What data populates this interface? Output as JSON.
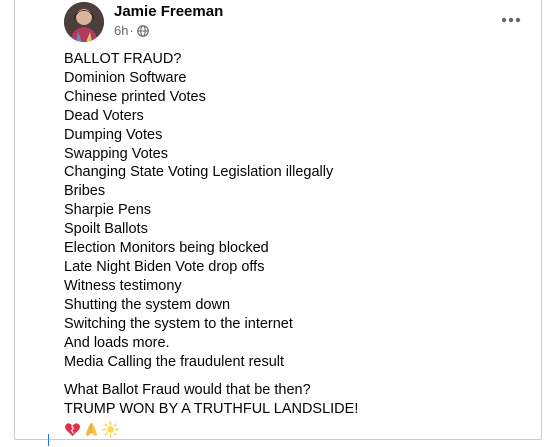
{
  "post": {
    "author": "Jamie Freeman",
    "timestamp": "6h",
    "separator": "·",
    "audience_icon": "globe-icon",
    "menu_icon": "more-options-icon",
    "lines": [
      "BALLOT FRAUD?",
      "Dominion Software",
      "Chinese printed Votes",
      "Dead Voters",
      "Dumping Votes",
      "Swapping Votes",
      "Changing State Voting Legislation illegally",
      "Bribes",
      "Sharpie Pens",
      "Spoilt Ballots",
      "Election Monitors being blocked",
      "Late Night Biden Vote drop offs",
      "Witness testimony",
      "Shutting the system down",
      "Switching the system to the internet",
      "And loads more.",
      "Media Calling the fraudulent result"
    ],
    "closing": [
      "What Ballot Fraud would that be then?",
      "TRUMP WON BY A TRUTHFUL LANDSLIDE!"
    ],
    "emojis": [
      "heart-icon",
      "praying-hands-icon",
      "sparkle-sun-icon"
    ]
  },
  "colors": {
    "text": "#050505",
    "meta": "#65676b",
    "border": "#c8cbd0"
  }
}
